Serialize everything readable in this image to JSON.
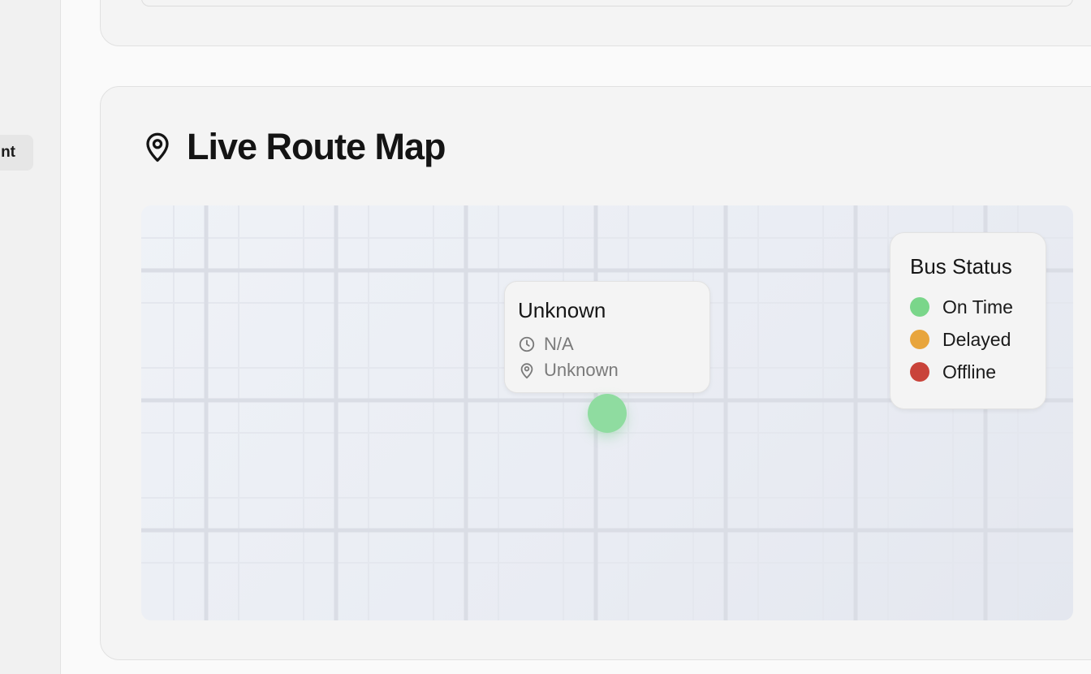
{
  "sidebar": {
    "active_item_label": "nt"
  },
  "map_section": {
    "title": "Live Route Map",
    "title_icon": "map-pin-icon"
  },
  "bus_popup": {
    "title": "Unknown",
    "time_icon": "clock-icon",
    "time": "N/A",
    "location_icon": "map-pin-icon",
    "location": "Unknown"
  },
  "bus_marker": {
    "status": "On Time",
    "color": "#8fdca0"
  },
  "legend": {
    "title": "Bus Status",
    "items": [
      {
        "label": "On Time",
        "color": "#7ad68a"
      },
      {
        "label": "Delayed",
        "color": "#e8a53c"
      },
      {
        "label": "Offline",
        "color": "#c9433a"
      }
    ]
  }
}
